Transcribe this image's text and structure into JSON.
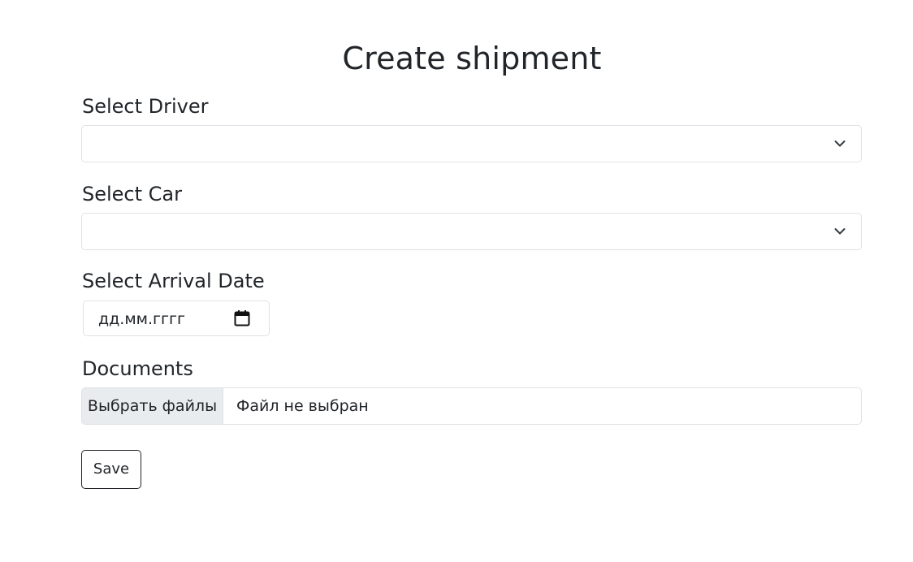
{
  "form": {
    "title": "Create shipment",
    "driver": {
      "label": "Select Driver",
      "selected": "",
      "icon": "chevron-down-icon"
    },
    "car": {
      "label": "Select Car",
      "selected": "",
      "icon": "chevron-down-icon"
    },
    "arrival_date": {
      "label": "Select Arrival Date",
      "placeholder": "дд.мм.гггг",
      "icon": "calendar-icon"
    },
    "documents": {
      "label": "Documents",
      "button_label": "Выбрать файлы",
      "status": "Файл не выбран"
    },
    "save_label": "Save"
  },
  "colors": {
    "text": "#212529",
    "border": "#dee2e6",
    "file_button_bg": "#e9ecef",
    "background": "#ffffff"
  }
}
